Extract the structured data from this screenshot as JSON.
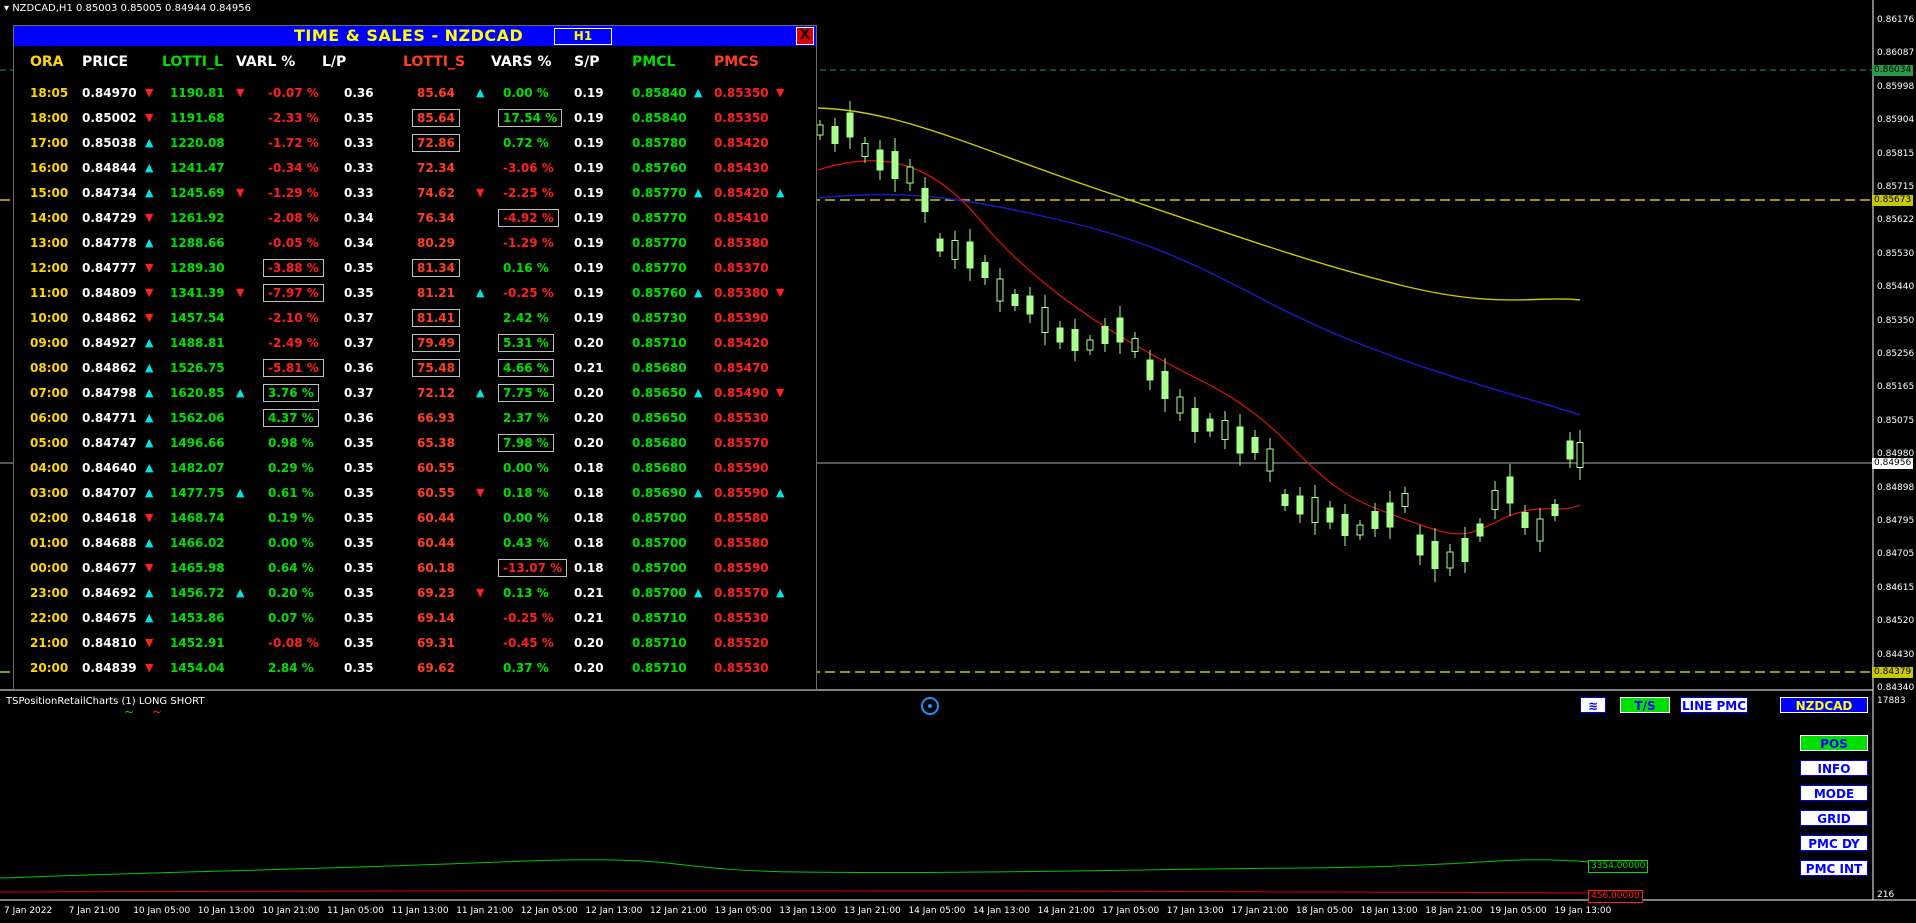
{
  "symbol_bar": {
    "text": "NZDCAD,H1  0.85003 0.85005 0.84944 0.84956"
  },
  "panel": {
    "title": "TIME & SALES  - NZDCAD",
    "timeframe": "H1",
    "close_label": "X",
    "headers": [
      "ORA",
      "PRICE",
      "LOTTI_L",
      "VARL %",
      "L/P",
      "LOTTI_S",
      "VARS %",
      "S/P",
      "PMCL",
      "PMCS"
    ],
    "header_colors": [
      "#ffd700",
      "#ffffff",
      "#00e000",
      "#ffffff",
      "#ffffff",
      "#ff4020",
      "#ffffff",
      "#ffffff",
      "#00e000",
      "#ff4020"
    ],
    "rows": [
      {
        "ora": "18:05",
        "price": "0.84970",
        "pdir": "down",
        "lotti_l": "1190.81",
        "ldir": "down",
        "varl": "-0.07 %",
        "varl_box": false,
        "lp": "0.36",
        "lotti_s": "85.64",
        "lsbox": false,
        "sdir": "up",
        "vars": "0.00 %",
        "vars_box": false,
        "sp": "0.19",
        "pmcl": "0.85840",
        "pmcldir": "up",
        "pmcs": "0.85350",
        "pmcsdir": "down"
      },
      {
        "ora": "18:00",
        "price": "0.85002",
        "pdir": "down",
        "lotti_l": "1191.68",
        "ldir": "",
        "varl": "-2.33 %",
        "varl_box": false,
        "lp": "0.35",
        "lotti_s": "85.64",
        "lsbox": true,
        "sdir": "",
        "vars": "17.54 %",
        "vars_box": true,
        "sp": "0.19",
        "pmcl": "0.85840",
        "pmcldir": "",
        "pmcs": "0.85350",
        "pmcsdir": ""
      },
      {
        "ora": "17:00",
        "price": "0.85038",
        "pdir": "up",
        "lotti_l": "1220.08",
        "ldir": "",
        "varl": "-1.72 %",
        "varl_box": false,
        "lp": "0.33",
        "lotti_s": "72.86",
        "lsbox": true,
        "sdir": "",
        "vars": "0.72 %",
        "vars_box": false,
        "sp": "0.19",
        "pmcl": "0.85780",
        "pmcldir": "",
        "pmcs": "0.85420",
        "pmcsdir": ""
      },
      {
        "ora": "16:00",
        "price": "0.84844",
        "pdir": "up",
        "lotti_l": "1241.47",
        "ldir": "",
        "varl": "-0.34 %",
        "varl_box": false,
        "lp": "0.33",
        "lotti_s": "72.34",
        "lsbox": false,
        "sdir": "",
        "vars": "-3.06 %",
        "vars_box": false,
        "sp": "0.19",
        "pmcl": "0.85760",
        "pmcldir": "",
        "pmcs": "0.85430",
        "pmcsdir": ""
      },
      {
        "ora": "15:00",
        "price": "0.84734",
        "pdir": "up",
        "lotti_l": "1245.69",
        "ldir": "down",
        "varl": "-1.29 %",
        "varl_box": false,
        "lp": "0.33",
        "lotti_s": "74.62",
        "lsbox": false,
        "sdir": "down",
        "vars": "-2.25 %",
        "vars_box": false,
        "sp": "0.19",
        "pmcl": "0.85770",
        "pmcldir": "up",
        "pmcs": "0.85420",
        "pmcsdir": "up"
      },
      {
        "ora": "14:00",
        "price": "0.84729",
        "pdir": "down",
        "lotti_l": "1261.92",
        "ldir": "",
        "varl": "-2.08 %",
        "varl_box": false,
        "lp": "0.34",
        "lotti_s": "76.34",
        "lsbox": false,
        "sdir": "",
        "vars": "-4.92 %",
        "vars_box": true,
        "sp": "0.19",
        "pmcl": "0.85770",
        "pmcldir": "",
        "pmcs": "0.85410",
        "pmcsdir": ""
      },
      {
        "ora": "13:00",
        "price": "0.84778",
        "pdir": "up",
        "lotti_l": "1288.66",
        "ldir": "",
        "varl": "-0.05 %",
        "varl_box": false,
        "lp": "0.34",
        "lotti_s": "80.29",
        "lsbox": false,
        "sdir": "",
        "vars": "-1.29 %",
        "vars_box": false,
        "sp": "0.19",
        "pmcl": "0.85770",
        "pmcldir": "",
        "pmcs": "0.85380",
        "pmcsdir": ""
      },
      {
        "ora": "12:00",
        "price": "0.84777",
        "pdir": "down",
        "lotti_l": "1289.30",
        "ldir": "",
        "varl": "-3.88 %",
        "varl_box": true,
        "lp": "0.35",
        "lotti_s": "81.34",
        "lsbox": true,
        "sdir": "",
        "vars": "0.16 %",
        "vars_box": false,
        "sp": "0.19",
        "pmcl": "0.85770",
        "pmcldir": "",
        "pmcs": "0.85370",
        "pmcsdir": ""
      },
      {
        "ora": "11:00",
        "price": "0.84809",
        "pdir": "down",
        "lotti_l": "1341.39",
        "ldir": "down",
        "varl": "-7.97 %",
        "varl_box": true,
        "lp": "0.35",
        "lotti_s": "81.21",
        "lsbox": false,
        "sdir": "up",
        "vars": "-0.25 %",
        "vars_box": false,
        "sp": "0.19",
        "pmcl": "0.85760",
        "pmcldir": "up",
        "pmcs": "0.85380",
        "pmcsdir": "down"
      },
      {
        "ora": "10:00",
        "price": "0.84862",
        "pdir": "down",
        "lotti_l": "1457.54",
        "ldir": "",
        "varl": "-2.10 %",
        "varl_box": false,
        "lp": "0.37",
        "lotti_s": "81.41",
        "lsbox": true,
        "sdir": "",
        "vars": "2.42 %",
        "vars_box": false,
        "sp": "0.19",
        "pmcl": "0.85730",
        "pmcldir": "",
        "pmcs": "0.85390",
        "pmcsdir": ""
      },
      {
        "ora": "09:00",
        "price": "0.84927",
        "pdir": "up",
        "lotti_l": "1488.81",
        "ldir": "",
        "varl": "-2.49 %",
        "varl_box": false,
        "lp": "0.37",
        "lotti_s": "79.49",
        "lsbox": true,
        "sdir": "",
        "vars": "5.31 %",
        "vars_box": true,
        "sp": "0.20",
        "pmcl": "0.85710",
        "pmcldir": "",
        "pmcs": "0.85420",
        "pmcsdir": ""
      },
      {
        "ora": "08:00",
        "price": "0.84862",
        "pdir": "up",
        "lotti_l": "1526.75",
        "ldir": "",
        "varl": "-5.81 %",
        "varl_box": true,
        "lp": "0.36",
        "lotti_s": "75.48",
        "lsbox": true,
        "sdir": "",
        "vars": "4.66 %",
        "vars_box": true,
        "sp": "0.21",
        "pmcl": "0.85680",
        "pmcldir": "",
        "pmcs": "0.85470",
        "pmcsdir": ""
      },
      {
        "ora": "07:00",
        "price": "0.84798",
        "pdir": "up",
        "lotti_l": "1620.85",
        "ldir": "up",
        "varl": "3.76 %",
        "varl_box": true,
        "lp": "0.37",
        "lotti_s": "72.12",
        "lsbox": false,
        "sdir": "up",
        "vars": "7.75 %",
        "vars_box": true,
        "sp": "0.20",
        "pmcl": "0.85650",
        "pmcldir": "up",
        "pmcs": "0.85490",
        "pmcsdir": "down"
      },
      {
        "ora": "06:00",
        "price": "0.84771",
        "pdir": "up",
        "lotti_l": "1562.06",
        "ldir": "",
        "varl": "4.37 %",
        "varl_box": true,
        "lp": "0.36",
        "lotti_s": "66.93",
        "lsbox": false,
        "sdir": "",
        "vars": "2.37 %",
        "vars_box": false,
        "sp": "0.20",
        "pmcl": "0.85650",
        "pmcldir": "",
        "pmcs": "0.85530",
        "pmcsdir": ""
      },
      {
        "ora": "05:00",
        "price": "0.84747",
        "pdir": "up",
        "lotti_l": "1496.66",
        "ldir": "",
        "varl": "0.98 %",
        "varl_box": false,
        "lp": "0.35",
        "lotti_s": "65.38",
        "lsbox": false,
        "sdir": "",
        "vars": "7.98 %",
        "vars_box": true,
        "sp": "0.20",
        "pmcl": "0.85680",
        "pmcldir": "",
        "pmcs": "0.85570",
        "pmcsdir": ""
      },
      {
        "ora": "04:00",
        "price": "0.84640",
        "pdir": "up",
        "lotti_l": "1482.07",
        "ldir": "",
        "varl": "0.29 %",
        "varl_box": false,
        "lp": "0.35",
        "lotti_s": "60.55",
        "lsbox": false,
        "sdir": "",
        "vars": "0.00 %",
        "vars_box": false,
        "sp": "0.18",
        "pmcl": "0.85680",
        "pmcldir": "",
        "pmcs": "0.85590",
        "pmcsdir": ""
      },
      {
        "ora": "03:00",
        "price": "0.84707",
        "pdir": "up",
        "lotti_l": "1477.75",
        "ldir": "up",
        "varl": "0.61 %",
        "varl_box": false,
        "lp": "0.35",
        "lotti_s": "60.55",
        "lsbox": false,
        "sdir": "down",
        "vars": "0.18 %",
        "vars_box": false,
        "sp": "0.18",
        "pmcl": "0.85690",
        "pmcldir": "up",
        "pmcs": "0.85590",
        "pmcsdir": "up"
      },
      {
        "ora": "02:00",
        "price": "0.84618",
        "pdir": "down",
        "lotti_l": "1468.74",
        "ldir": "",
        "varl": "0.19 %",
        "varl_box": false,
        "lp": "0.35",
        "lotti_s": "60.44",
        "lsbox": false,
        "sdir": "",
        "vars": "0.00 %",
        "vars_box": false,
        "sp": "0.18",
        "pmcl": "0.85700",
        "pmcldir": "",
        "pmcs": "0.85580",
        "pmcsdir": ""
      },
      {
        "ora": "01:00",
        "price": "0.84688",
        "pdir": "up",
        "lotti_l": "1466.02",
        "ldir": "",
        "varl": "0.00 %",
        "varl_box": false,
        "lp": "0.35",
        "lotti_s": "60.44",
        "lsbox": false,
        "sdir": "",
        "vars": "0.43 %",
        "vars_box": false,
        "sp": "0.18",
        "pmcl": "0.85700",
        "pmcldir": "",
        "pmcs": "0.85580",
        "pmcsdir": ""
      },
      {
        "ora": "00:00",
        "price": "0.84677",
        "pdir": "down",
        "lotti_l": "1465.98",
        "ldir": "",
        "varl": "0.64 %",
        "varl_box": false,
        "lp": "0.35",
        "lotti_s": "60.18",
        "lsbox": false,
        "sdir": "",
        "vars": "-13.07 %",
        "vars_box": true,
        "sp": "0.18",
        "pmcl": "0.85700",
        "pmcldir": "",
        "pmcs": "0.85590",
        "pmcsdir": ""
      },
      {
        "ora": "23:00",
        "price": "0.84692",
        "pdir": "up",
        "lotti_l": "1456.72",
        "ldir": "up",
        "varl": "0.20 %",
        "varl_box": false,
        "lp": "0.35",
        "lotti_s": "69.23",
        "lsbox": false,
        "sdir": "down",
        "vars": "0.13 %",
        "vars_box": false,
        "sp": "0.21",
        "pmcl": "0.85700",
        "pmcldir": "up",
        "pmcs": "0.85570",
        "pmcsdir": "up"
      },
      {
        "ora": "22:00",
        "price": "0.84675",
        "pdir": "up",
        "lotti_l": "1453.86",
        "ldir": "",
        "varl": "0.07 %",
        "varl_box": false,
        "lp": "0.35",
        "lotti_s": "69.14",
        "lsbox": false,
        "sdir": "",
        "vars": "-0.25 %",
        "vars_box": false,
        "sp": "0.21",
        "pmcl": "0.85710",
        "pmcldir": "",
        "pmcs": "0.85530",
        "pmcsdir": ""
      },
      {
        "ora": "21:00",
        "price": "0.84810",
        "pdir": "down",
        "lotti_l": "1452.91",
        "ldir": "",
        "varl": "-0.08 %",
        "varl_box": false,
        "lp": "0.35",
        "lotti_s": "69.31",
        "lsbox": false,
        "sdir": "",
        "vars": "-0.45 %",
        "vars_box": false,
        "sp": "0.20",
        "pmcl": "0.85710",
        "pmcldir": "",
        "pmcs": "0.85520",
        "pmcsdir": ""
      },
      {
        "ora": "20:00",
        "price": "0.84839",
        "pdir": "down",
        "lotti_l": "1454.04",
        "ldir": "",
        "varl": "2.84 %",
        "varl_box": false,
        "lp": "0.35",
        "lotti_s": "69.62",
        "lsbox": false,
        "sdir": "",
        "vars": "0.37 %",
        "vars_box": false,
        "sp": "0.20",
        "pmcl": "0.85710",
        "pmcldir": "",
        "pmcs": "0.85530",
        "pmcsdir": ""
      }
    ]
  },
  "price_axis": {
    "labels": [
      "0.86176",
      "0.86087",
      "0.85998",
      "0.85904",
      "0.85815",
      "0.85715",
      "0.85622",
      "0.85530",
      "0.85440",
      "0.85350",
      "0.85256",
      "0.85165",
      "0.85075",
      "0.84980",
      "0.84898",
      "0.84795",
      "0.84705",
      "0.84615",
      "0.84520",
      "0.84430",
      "0.84340"
    ],
    "tag_top": "0.86034",
    "tag_yellow": "0.85673",
    "tag_current": "0.84956",
    "tag_bottom": "0.84379"
  },
  "lower_panel": {
    "label": "TSPositionRetailCharts (1) LONG SHORT",
    "axis_top": "17883",
    "axis_bottom": "216",
    "value_green": "3354.00000",
    "value_red": "456.00000"
  },
  "buttons": {
    "ts": "T/S",
    "line_pmc": "LINE PMC",
    "symbol": "NZDCAD",
    "pos": "POS",
    "info": "INFO",
    "mode": "MODE",
    "grid": "GRID",
    "pmc_dy": "PMC DY",
    "pmc_int": "PMC INT"
  },
  "time_axis": [
    "7 Jan 2022",
    "7 Jan 21:00",
    "10 Jan 05:00",
    "10 Jan 13:00",
    "10 Jan 21:00",
    "11 Jan 05:00",
    "11 Jan 13:00",
    "11 Jan 21:00",
    "12 Jan 05:00",
    "12 Jan 13:00",
    "12 Jan 21:00",
    "13 Jan 05:00",
    "13 Jan 13:00",
    "13 Jan 21:00",
    "14 Jan 05:00",
    "14 Jan 13:00",
    "14 Jan 21:00",
    "17 Jan 05:00",
    "17 Jan 13:00",
    "17 Jan 21:00",
    "18 Jan 05:00",
    "18 Jan 13:00",
    "18 Jan 21:00",
    "19 Jan 05:00",
    "19 Jan 13:00"
  ],
  "colors": {
    "bull": "#a8ff8c",
    "ma_red": "#e01010",
    "ma_blue": "#1a1acc",
    "ma_yellow": "#c8c800",
    "level_yellow": "#c8c800",
    "level_green": "#2a9a4a"
  }
}
